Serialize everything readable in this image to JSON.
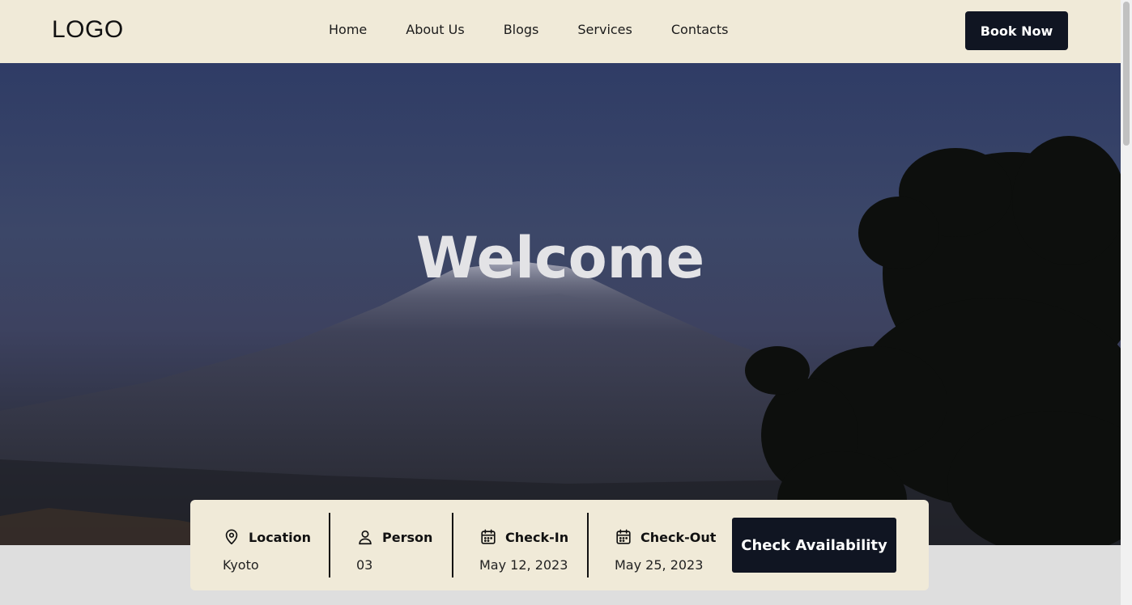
{
  "header": {
    "logo": "LOGO",
    "nav": [
      "Home",
      "About Us",
      "Blogs",
      "Services",
      "Contacts"
    ],
    "book_label": "Book Now"
  },
  "hero": {
    "title": "Welcome"
  },
  "booking": {
    "location": {
      "label": "Location",
      "value": "Kyoto",
      "icon": "map-pin-icon"
    },
    "person": {
      "label": "Person",
      "value": "03",
      "icon": "user-icon"
    },
    "checkin": {
      "label": "Check-In",
      "value": "May 12, 2023",
      "icon": "calendar-icon"
    },
    "checkout": {
      "label": "Check-Out",
      "value": "May 25, 2023",
      "icon": "calendar-icon"
    },
    "button_label": "Check Availability"
  },
  "colors": {
    "header_bg": "#f0ead8",
    "button_bg": "#101522",
    "hero_sky": "#3c4768"
  }
}
